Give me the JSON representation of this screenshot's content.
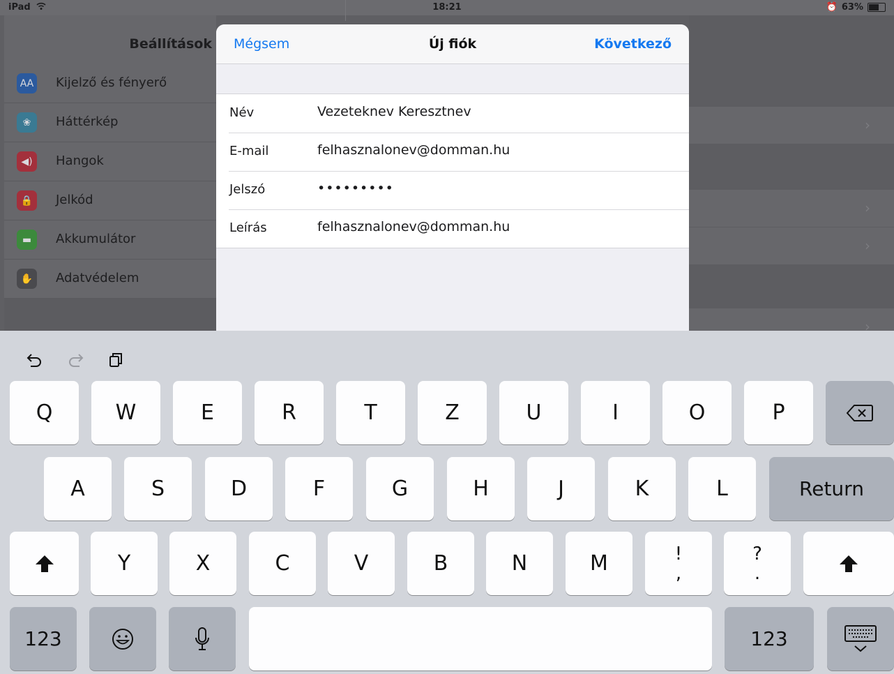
{
  "status_bar": {
    "carrier": "iPad",
    "time": "18:21",
    "battery": "63%",
    "battery_level": 0.63
  },
  "settings": {
    "title": "Beállítások",
    "items": [
      {
        "label": "Kijelző és fényerő",
        "icon": "display-brightness-icon",
        "color": "#2b5a9e"
      },
      {
        "label": "Háttérkép",
        "icon": "wallpaper-icon",
        "color": "#3a7a93"
      },
      {
        "label": "Hangok",
        "icon": "sounds-icon",
        "color": "#a3303c"
      },
      {
        "label": "Jelkód",
        "icon": "passcode-icon",
        "color": "#a3303c"
      },
      {
        "label": "Akkumulátor",
        "icon": "battery-icon",
        "color": "#3c8a3c"
      },
      {
        "label": "Adatvédelem",
        "icon": "privacy-hand-icon",
        "color": "#4a4a4e"
      }
    ]
  },
  "modal": {
    "cancel": "Mégsem",
    "title": "Új fiók",
    "next": "Következő",
    "fields": [
      {
        "label": "Név",
        "value": "Vezeteknev Keresztnev"
      },
      {
        "label": "E-mail",
        "value": "felhasznalonev@domman.hu"
      },
      {
        "label": "Jelszó",
        "value": "•••••••••"
      },
      {
        "label": "Leírás",
        "value": "felhasznalonev@domman.hu"
      }
    ]
  },
  "keyboard": {
    "row1": [
      "Q",
      "W",
      "E",
      "R",
      "T",
      "Z",
      "U",
      "I",
      "O",
      "P"
    ],
    "row2": [
      "A",
      "S",
      "D",
      "F",
      "G",
      "H",
      "J",
      "K",
      "L"
    ],
    "row3": [
      "Y",
      "X",
      "C",
      "V",
      "B",
      "N",
      "M"
    ],
    "return": "Return",
    "numbers": "123",
    "punct1": [
      "!",
      ","
    ],
    "punct2": [
      "?",
      "."
    ]
  },
  "colors": {
    "accent": "#1579f0",
    "keyboard_bg": "#d2d5db",
    "key_light": "#fdfdfe",
    "key_dark": "#acb1ba"
  }
}
